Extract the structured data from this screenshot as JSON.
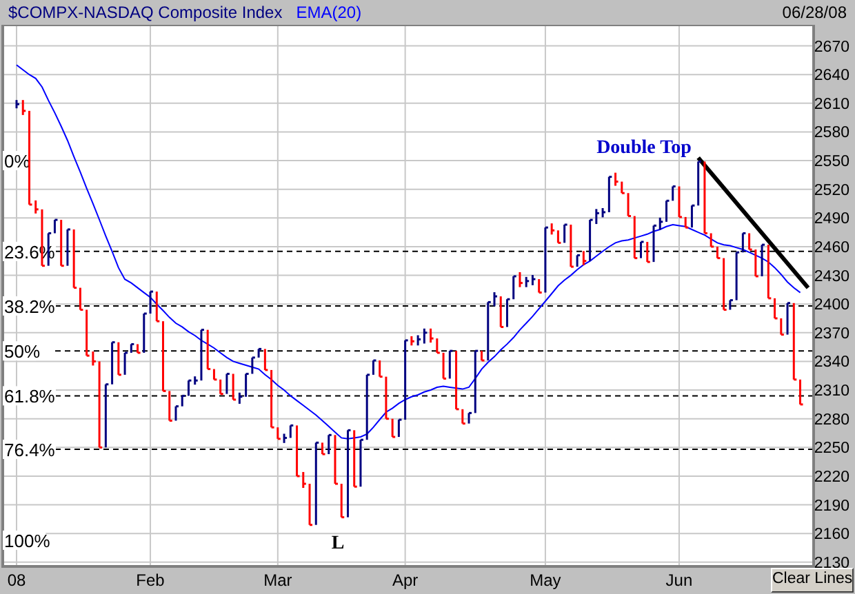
{
  "header": {
    "symbol": "$COMPX-NASDAQ Composite Index",
    "date": "06/28/08"
  },
  "chart": {
    "chart_data": {
      "type": "line",
      "grid": true,
      "ylim": [
        2127,
        2692
      ],
      "categories": [
        "08",
        null,
        null,
        null,
        null,
        null,
        null,
        null,
        null,
        null,
        null,
        null,
        null,
        null,
        null,
        null,
        null,
        null,
        null,
        null,
        null,
        "Feb",
        null,
        null,
        null,
        null,
        null,
        null,
        null,
        null,
        null,
        null,
        null,
        null,
        null,
        null,
        null,
        null,
        null,
        null,
        null,
        "Mar",
        null,
        null,
        null,
        null,
        null,
        null,
        null,
        null,
        null,
        null,
        null,
        null,
        null,
        null,
        null,
        null,
        null,
        null,
        null,
        "Apr",
        null,
        null,
        null,
        null,
        null,
        null,
        null,
        null,
        null,
        null,
        null,
        null,
        null,
        null,
        null,
        null,
        null,
        null,
        null,
        null,
        null,
        "May",
        null,
        null,
        null,
        null,
        null,
        null,
        null,
        null,
        null,
        null,
        null,
        null,
        null,
        null,
        null,
        null,
        null,
        null,
        null,
        null,
        "Jun",
        null,
        null,
        null,
        null,
        null,
        null,
        null,
        null,
        null,
        null,
        null,
        null,
        null,
        null,
        null,
        null,
        null,
        null,
        null
      ],
      "yticks": [
        2130,
        2160,
        2190,
        2220,
        2250,
        2280,
        2310,
        2340,
        2370,
        2400,
        2430,
        2460,
        2490,
        2520,
        2550,
        2580,
        2610,
        2640,
        2670
      ],
      "series": [
        {
          "name": "EMA(20)",
          "color": "#0000ff",
          "values": [
            2650,
            2645,
            2640,
            2636,
            2627,
            2613,
            2600,
            2586,
            2571,
            2554,
            2538,
            2521,
            2505,
            2488,
            2471,
            2455,
            2438,
            2426,
            2422,
            2417,
            2412,
            2407,
            2400,
            2393,
            2386,
            2380,
            2376,
            2371,
            2367,
            2362,
            2358,
            2354,
            2349,
            2344,
            2340,
            2338,
            2336,
            2334,
            2332,
            2326,
            2321,
            2315,
            2310,
            2304,
            2299,
            2294,
            2289,
            2284,
            2278,
            2272,
            2266,
            2260,
            2259,
            2260,
            2261,
            2264,
            2271,
            2279,
            2287,
            2291,
            2296,
            2300,
            2303,
            2305,
            2308,
            2310,
            2313,
            2314,
            2313,
            2312,
            2311,
            2313,
            2322,
            2332,
            2339,
            2345,
            2352,
            2358,
            2365,
            2373,
            2380,
            2387,
            2395,
            2403,
            2411,
            2419,
            2425,
            2430,
            2436,
            2441,
            2445,
            2450,
            2455,
            2460,
            2464,
            2466,
            2467,
            2469,
            2471,
            2473,
            2476,
            2478,
            2481,
            2483,
            2482,
            2481,
            2478,
            2475,
            2472,
            2468,
            2464,
            2462,
            2461,
            2459,
            2457,
            2454,
            2451,
            2448,
            2444,
            2438,
            2431,
            2423,
            2417,
            2412
          ]
        }
      ],
      "annotations": [
        {
          "text": "0%"
        },
        {
          "text": "23.6%"
        },
        {
          "text": "38.2%"
        },
        {
          "text": "50%"
        },
        {
          "text": "61.8%"
        },
        {
          "text": "76.4%"
        },
        {
          "text": "100%"
        },
        {
          "text": "Double Top"
        },
        {
          "text": "L"
        }
      ]
    }
  },
  "clear_button": "Clear Lines"
}
